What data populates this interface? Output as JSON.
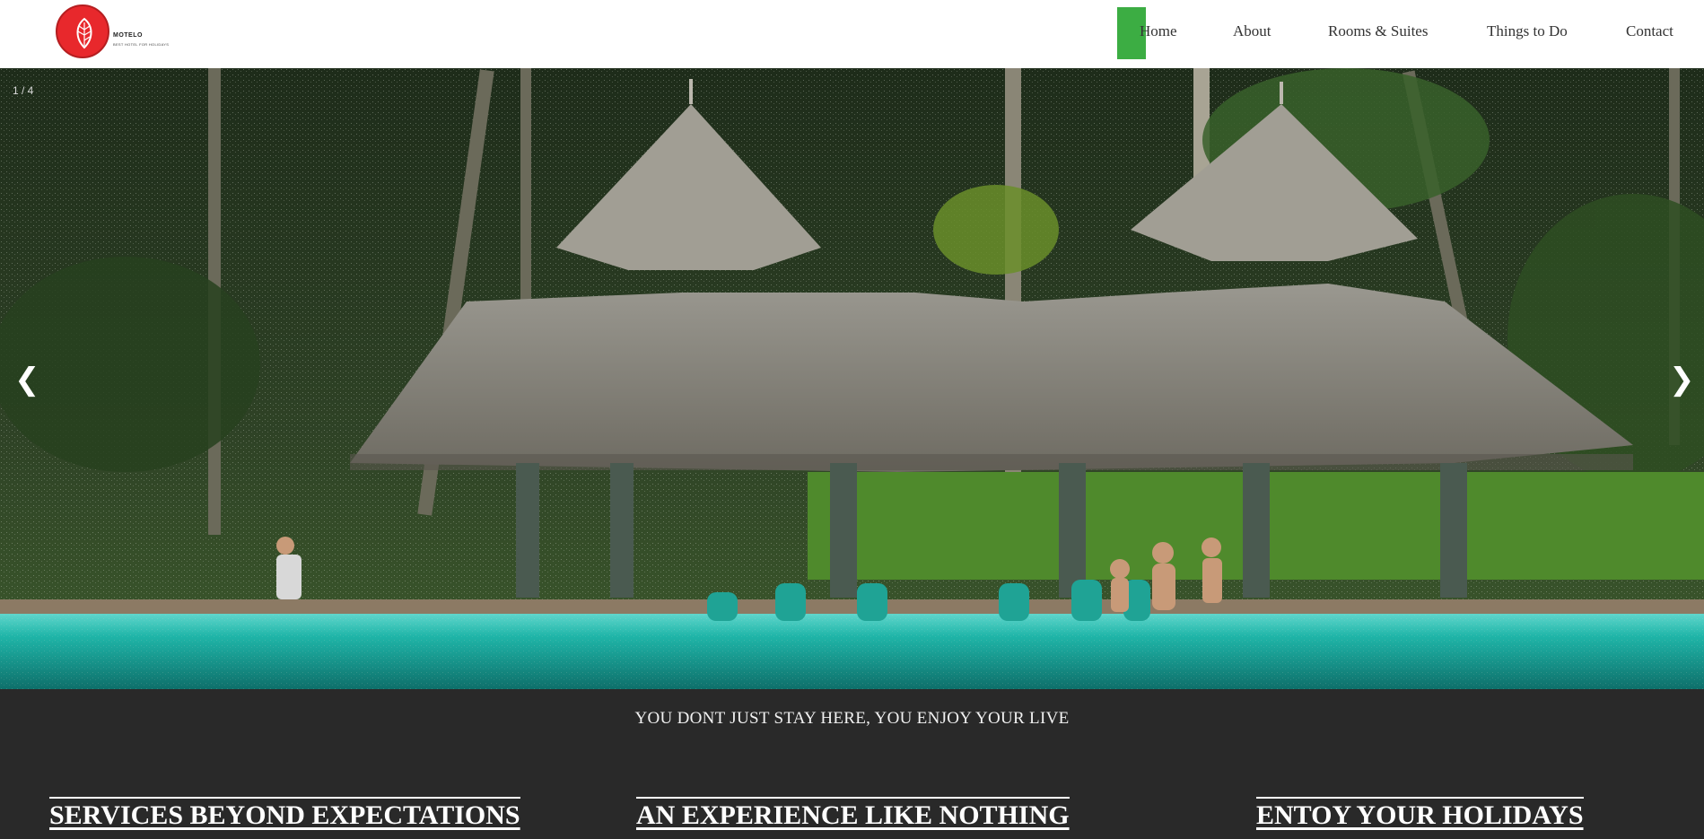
{
  "logo": {
    "name": "MOTELO",
    "tagline": "BEST HOTEL FOR HOLIDAYS"
  },
  "nav": {
    "items": [
      {
        "label": "Home",
        "active": true
      },
      {
        "label": "About"
      },
      {
        "label": "Rooms & Suites"
      },
      {
        "label": "Things to Do"
      },
      {
        "label": "Contact"
      }
    ]
  },
  "hero": {
    "slide_counter": "1 / 4",
    "prev_arrow": "❮",
    "next_arrow": "❯"
  },
  "band": {
    "tagline": "YOU DONT JUST STAY HERE, YOU ENJOY YOUR LIVE",
    "features": [
      "SERVICES BEYOND EXPECTATIONS",
      "AN EXPERIENCE LIKE NOTHING",
      "ENTOY YOUR HOLIDAYS"
    ]
  },
  "colors": {
    "accent": "#3cad43",
    "logo_red": "#e8282c",
    "band_bg": "#292929",
    "pool": "#1fb5a8"
  }
}
